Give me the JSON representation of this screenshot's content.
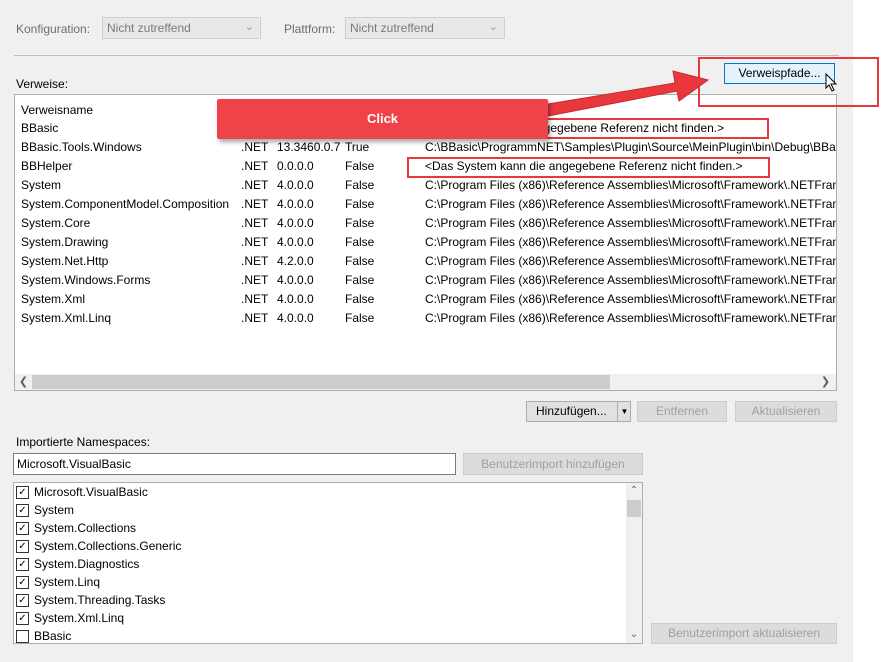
{
  "config": {
    "konfiguration_label": "Konfiguration:",
    "konfiguration_value": "Nicht zutreffend",
    "plattform_label": "Plattform:",
    "plattform_value": "Nicht zutreffend"
  },
  "references": {
    "section_label": "Verweise:",
    "paths_button": "Verweispfade...",
    "column_name": "Verweisname",
    "rows": [
      {
        "name": "BBasic",
        "type": "",
        "version": "",
        "copy": "",
        "path": "ngegebene Referenz nicht finden.>"
      },
      {
        "name": "BBasic.Tools.Windows",
        "type": ".NET",
        "version": "13.3460.0.7",
        "copy": "True",
        "path": "C:\\BBasic\\ProgrammNET\\Samples\\Plugin\\Source\\MeinPlugin\\bin\\Debug\\BBa"
      },
      {
        "name": "BBHelper",
        "type": ".NET",
        "version": "0.0.0.0",
        "copy": "False",
        "path": "<Das System kann die angegebene Referenz nicht finden.>"
      },
      {
        "name": "System",
        "type": ".NET",
        "version": "4.0.0.0",
        "copy": "False",
        "path": "C:\\Program Files (x86)\\Reference Assemblies\\Microsoft\\Framework\\.NETFram"
      },
      {
        "name": "System.ComponentModel.Composition",
        "type": ".NET",
        "version": "4.0.0.0",
        "copy": "False",
        "path": "C:\\Program Files (x86)\\Reference Assemblies\\Microsoft\\Framework\\.NETFram"
      },
      {
        "name": "System.Core",
        "type": ".NET",
        "version": "4.0.0.0",
        "copy": "False",
        "path": "C:\\Program Files (x86)\\Reference Assemblies\\Microsoft\\Framework\\.NETFram"
      },
      {
        "name": "System.Drawing",
        "type": ".NET",
        "version": "4.0.0.0",
        "copy": "False",
        "path": "C:\\Program Files (x86)\\Reference Assemblies\\Microsoft\\Framework\\.NETFram"
      },
      {
        "name": "System.Net.Http",
        "type": ".NET",
        "version": "4.2.0.0",
        "copy": "False",
        "path": "C:\\Program Files (x86)\\Reference Assemblies\\Microsoft\\Framework\\.NETFram"
      },
      {
        "name": "System.Windows.Forms",
        "type": ".NET",
        "version": "4.0.0.0",
        "copy": "False",
        "path": "C:\\Program Files (x86)\\Reference Assemblies\\Microsoft\\Framework\\.NETFram"
      },
      {
        "name": "System.Xml",
        "type": ".NET",
        "version": "4.0.0.0",
        "copy": "False",
        "path": "C:\\Program Files (x86)\\Reference Assemblies\\Microsoft\\Framework\\.NETFram"
      },
      {
        "name": "System.Xml.Linq",
        "type": ".NET",
        "version": "4.0.0.0",
        "copy": "False",
        "path": "C:\\Program Files (x86)\\Reference Assemblies\\Microsoft\\Framework\\.NETFram"
      }
    ],
    "add_button": "Hinzufügen...",
    "remove_button": "Entfernen",
    "update_button": "Aktualisieren"
  },
  "namespaces": {
    "section_label": "Importierte Namespaces:",
    "input_value": "Microsoft.VisualBasic",
    "add_import_button": "Benutzerimport hinzufügen",
    "update_import_button": "Benutzerimport aktualisieren",
    "items": [
      {
        "label": "Microsoft.VisualBasic",
        "checked": true
      },
      {
        "label": "System",
        "checked": true
      },
      {
        "label": "System.Collections",
        "checked": true
      },
      {
        "label": "System.Collections.Generic",
        "checked": true
      },
      {
        "label": "System.Diagnostics",
        "checked": true
      },
      {
        "label": "System.Linq",
        "checked": true
      },
      {
        "label": "System.Threading.Tasks",
        "checked": true
      },
      {
        "label": "System.Xml.Linq",
        "checked": true
      },
      {
        "label": "BBasic",
        "checked": false
      }
    ]
  },
  "annotation": {
    "callout_text": "Click",
    "color": "#e8383d"
  }
}
